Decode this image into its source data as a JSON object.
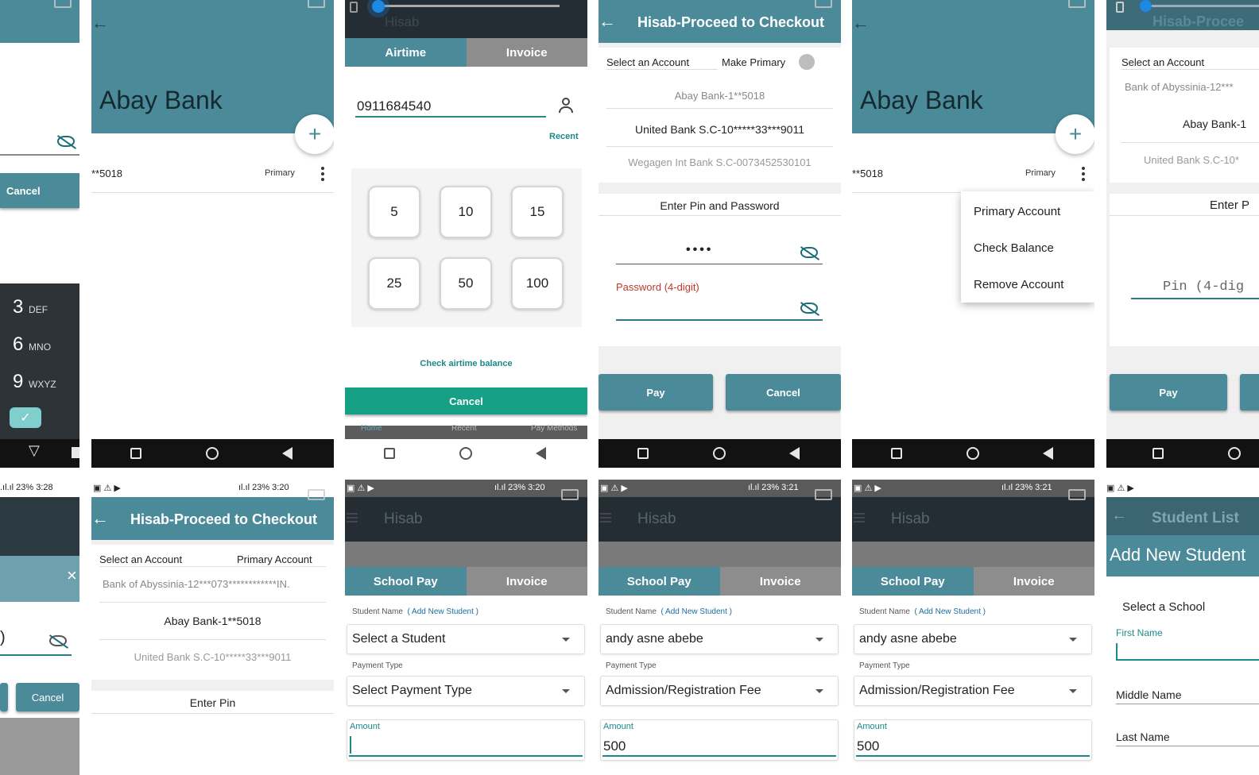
{
  "p1": {
    "cancel": "Cancel",
    "keys": [
      {
        "num": "3",
        "letters": "DEF"
      },
      {
        "num": "6",
        "letters": "MNO"
      },
      {
        "num": "9",
        "letters": "WXYZ"
      }
    ]
  },
  "p2": {
    "bank_title": "Abay Bank",
    "account": "**5018",
    "badge": "Primary",
    "fab": "+"
  },
  "p3": {
    "tabs": [
      "Airtime",
      "Invoice"
    ],
    "phone": "0911684540",
    "recent": "Recent",
    "amounts": [
      "5",
      "10",
      "15",
      "25",
      "50",
      "100"
    ],
    "check_balance": "Check airtime balance",
    "cancel": "Cancel",
    "bottom_nav": [
      "Home",
      "Recent",
      "Pay Methods"
    ],
    "faded_title": "Hisab"
  },
  "p4": {
    "title": "Hisab-Proceed to Checkout",
    "select_account": "Select an Account",
    "make_primary": "Make Primary",
    "accounts": [
      "Abay Bank-1**5018",
      "United Bank S.C-10*****33***9011",
      "Wegagen Int Bank S.C-0073452530101"
    ],
    "pin_header": "Enter Pin and Password",
    "pin_value": "••••",
    "password_label": "Password (4-digit)",
    "pay": "Pay",
    "cancel": "Cancel"
  },
  "p5": {
    "bank_title": "Abay Bank",
    "account": "**5018",
    "badge": "Primary",
    "fab": "+",
    "menu": [
      "Primary Account",
      "Check Balance",
      "Remove Account"
    ]
  },
  "p6": {
    "faded_title": "Hisab-Procee",
    "select_account": "Select an Account",
    "accounts": [
      "Bank of Abyssinia-12***",
      "Abay Bank-1",
      "United Bank S.C-10*"
    ],
    "pin_header": "Enter P",
    "pin_placeholder": "Pin (4-dig",
    "pay": "Pay"
  },
  "p7": {
    "status": ".ıl.ıl  23%  3:28",
    "cancel": "Cancel",
    "close": "×"
  },
  "p8": {
    "status_left": "▣ ⚠ ▶",
    "status_right": "ıl.ıl  23%  3:20",
    "title": "Hisab-Proceed to Checkout",
    "select_account": "Select an Account",
    "primary_account": "Primary Account",
    "accounts": [
      "Bank of Abyssinia-12***073************IN.",
      "Abay Bank-1**5018",
      "United Bank S.C-10*****33***9011"
    ],
    "pin_header": "Enter Pin"
  },
  "p9": {
    "status_left": "▣ ⚠ ▶",
    "status_right": "ıl.ıl  23%  3:20",
    "app": "Hisab",
    "tabs": [
      "School Pay",
      "Invoice"
    ],
    "student_label": "Student Name",
    "add_student": "( Add New Student )",
    "student": "Select a Student",
    "payment_label": "Payment Type",
    "payment": "Select Payment Type",
    "amount_label": "Amount",
    "amount": ""
  },
  "p10": {
    "status_left": "▣ ⚠ ▶",
    "status_right": "ıl.ıl  23%  3:21",
    "app": "Hisab",
    "tabs": [
      "School Pay",
      "Invoice"
    ],
    "student_label": "Student Name",
    "add_student": "( Add New Student )",
    "student": "andy asne abebe",
    "payment_label": "Payment Type",
    "payment": "Admission/Registration Fee",
    "amount_label": "Amount",
    "amount": "500"
  },
  "p11": {
    "status_left": "▣ ⚠ ▶",
    "status_right": "ıl.ıl  23%  3:21",
    "app": "Hisab",
    "tabs": [
      "School Pay",
      "Invoice"
    ],
    "student_label": "Student Name",
    "add_student": "( Add New Student )",
    "student": "andy asne abebe",
    "payment_label": "Payment Type",
    "payment": "Admission/Registration Fee",
    "amount_label": "Amount",
    "amount": "500"
  },
  "p12": {
    "status_left": "▣ ⚠ ▶",
    "faded_title": "Student List",
    "title": "Add New Student",
    "school": "Select a School",
    "first_name": "First Name",
    "middle_name": "Middle Name",
    "last_name": "Last Name"
  }
}
